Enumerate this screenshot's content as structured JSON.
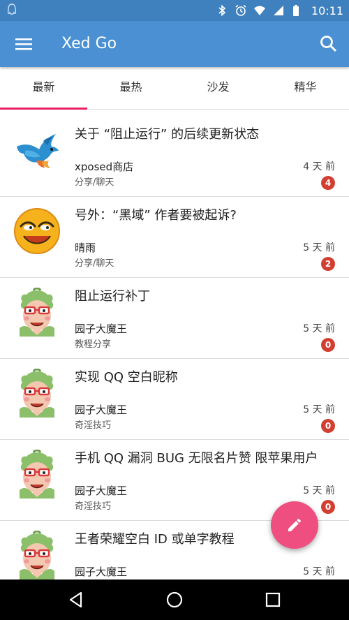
{
  "status_bar": {
    "time": "10:11",
    "icons": [
      "qq-notification-icon",
      "bluetooth-icon",
      "alarm-icon",
      "wifi-icon",
      "signal-icon",
      "battery-icon"
    ]
  },
  "app_bar": {
    "title": "Xed Go",
    "color": "#4a90d2",
    "icons": [
      "menu-icon",
      "search-icon"
    ]
  },
  "tabs": [
    {
      "label": "最新",
      "active": true
    },
    {
      "label": "最热",
      "active": false
    },
    {
      "label": "沙发",
      "active": false
    },
    {
      "label": "精华",
      "active": false
    }
  ],
  "accent_color": "#e91e63",
  "badge_color": "#d23f31",
  "posts": [
    {
      "title": "关于 “阻止运行” 的后续更新状态",
      "author": "xposed商店",
      "category": "分享/聊天",
      "time": "4 天 前",
      "replies": "4",
      "avatar": "bird-logo-avatar"
    },
    {
      "title": "号外：“黑域” 作者要被起诉?",
      "author": "晴雨",
      "category": "分享/聊天",
      "time": "5 天 前",
      "replies": "2",
      "avatar": "smiley-face-avatar"
    },
    {
      "title": "阻止运行补丁",
      "author": "园子大魔王",
      "category": "教程分享",
      "time": "5 天 前",
      "replies": "0",
      "avatar": "cartoon-character-avatar"
    },
    {
      "title": "实现 QQ 空白昵称",
      "author": "园子大魔王",
      "category": "奇淫技巧",
      "time": "5 天 前",
      "replies": "0",
      "avatar": "cartoon-character-avatar"
    },
    {
      "title": "手机 QQ 漏洞 BUG 无限名片赞 限苹果用户",
      "author": "园子大魔王",
      "category": "奇淫技巧",
      "time": "5 天 前",
      "replies": "0",
      "avatar": "cartoon-character-avatar"
    },
    {
      "title": "王者荣耀空白 ID 或单字教程",
      "author": "园子大魔王",
      "category": "",
      "time": "5 天 前",
      "replies": "",
      "avatar": "cartoon-character-avatar"
    }
  ],
  "fab": {
    "icon": "pencil-icon",
    "color": "#ef4f80"
  },
  "nav_bar": {
    "icons": [
      "back-icon",
      "home-icon",
      "recents-icon"
    ]
  }
}
